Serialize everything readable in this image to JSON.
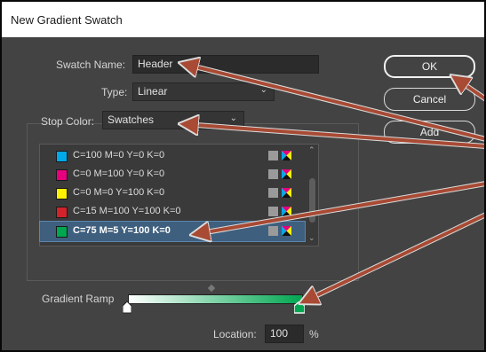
{
  "window": {
    "title": "New Gradient Swatch"
  },
  "swatch_name": {
    "label": "Swatch Name:",
    "value": "Header"
  },
  "type": {
    "label": "Type:",
    "value": "Linear"
  },
  "stop_color": {
    "label": "Stop Color:",
    "value": "Swatches"
  },
  "buttons": {
    "ok": "OK",
    "cancel": "Cancel",
    "add": "Add"
  },
  "swatches": [
    {
      "name": "C=100 M=0 Y=0 K=0",
      "color": "#00a9e8",
      "selected": false
    },
    {
      "name": "C=0 M=100 Y=0 K=0",
      "color": "#e6007e",
      "selected": false
    },
    {
      "name": "C=0 M=0 Y=100 K=0",
      "color": "#fff200",
      "selected": false
    },
    {
      "name": "C=15 M=100 Y=100 K=0",
      "color": "#d2232a",
      "selected": false
    },
    {
      "name": "C=75 M=5 Y=100 K=0",
      "color": "#00a650",
      "selected": true
    }
  ],
  "gradient_ramp": {
    "label": "Gradient Ramp",
    "start_color": "#ffffff",
    "end_color": "#00a650"
  },
  "location": {
    "label": "Location:",
    "value": "100",
    "unit": "%"
  },
  "colors": {
    "dialog_bg": "#434343",
    "arrow": "#a84a34",
    "selection": "#3f5f7e"
  },
  "icons": [
    "swatch-chip",
    "gray-square-icon",
    "cmyk-mode-icon",
    "chevron-down-icon",
    "color-stop-icon",
    "midpoint-diamond-icon"
  ]
}
